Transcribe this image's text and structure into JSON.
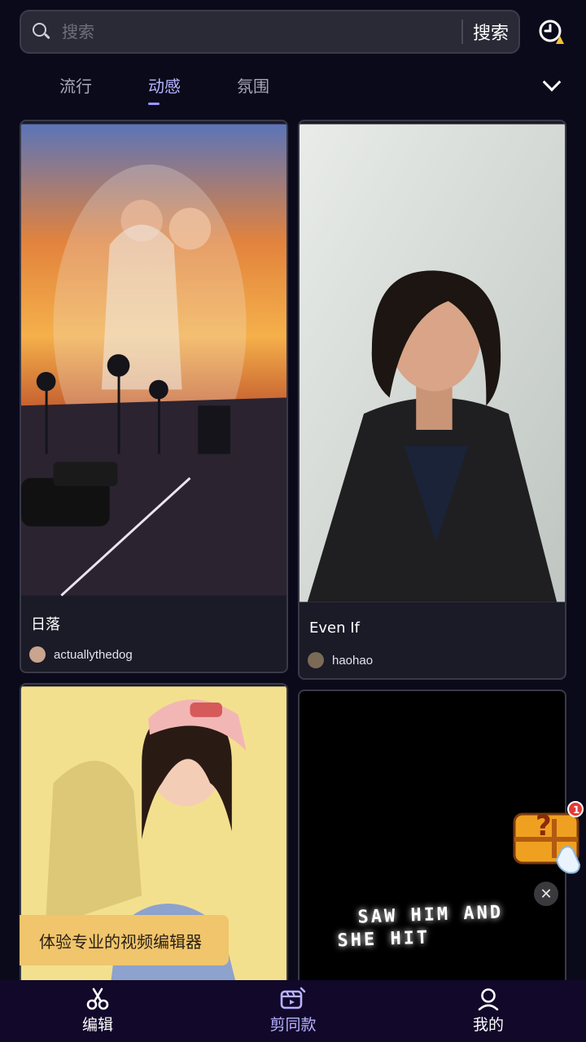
{
  "search": {
    "placeholder": "搜索",
    "button_label": "搜索"
  },
  "tabs": [
    {
      "label": "流行",
      "active": false
    },
    {
      "label": "动感",
      "active": true
    },
    {
      "label": "氛围",
      "active": false
    }
  ],
  "cards": [
    {
      "title": "日落",
      "author": "actuallythedog"
    },
    {
      "title": "Even If",
      "author": "haohao"
    },
    {
      "title": "",
      "author": ""
    },
    {
      "title": "",
      "author": "",
      "overlay_text": [
        "SAW HIM AND",
        "SHE HIT"
      ]
    }
  ],
  "promo": {
    "text": "体验专业的视频编辑器"
  },
  "reward": {
    "badge": "1"
  },
  "bottom_nav": [
    {
      "label": "编辑",
      "icon": "scissors-icon",
      "active": false
    },
    {
      "label": "剪同款",
      "icon": "template-icon",
      "active": true
    },
    {
      "label": "我的",
      "icon": "profile-icon",
      "active": false
    }
  ],
  "colors": {
    "background": "#0b0a1a",
    "accent": "#b7b4ff",
    "promo": "#f0c56c",
    "badge": "#e53935"
  }
}
